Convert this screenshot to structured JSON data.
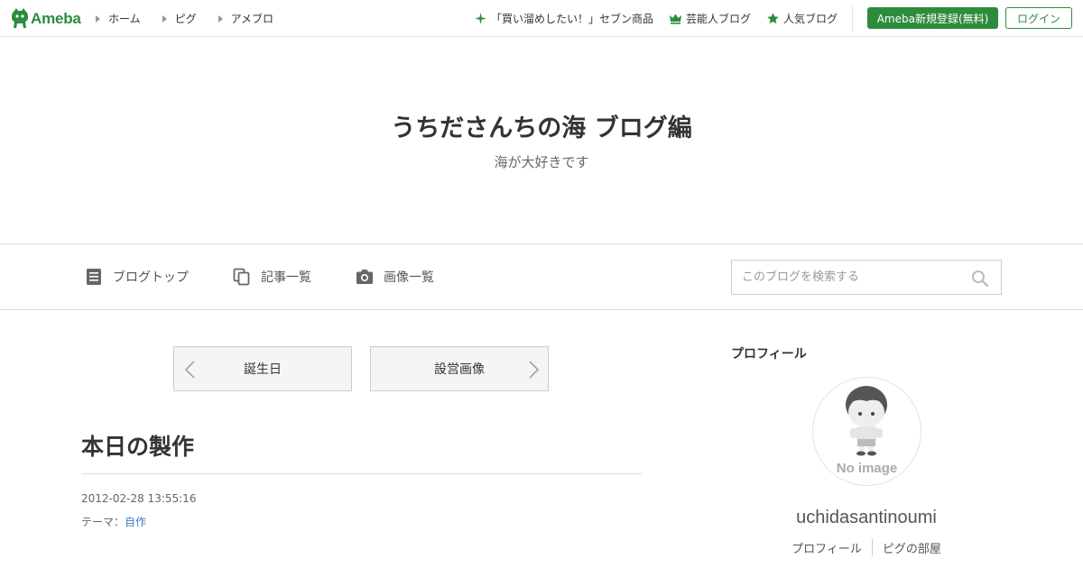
{
  "header": {
    "logo_text": "Ameba",
    "left_nav": [
      {
        "label": "ホーム"
      },
      {
        "label": "ピグ"
      },
      {
        "label": "アメブロ"
      }
    ],
    "right_nav": [
      {
        "label": "「買い溜めしたい！」セブン商品",
        "icon": "sparkle-icon"
      },
      {
        "label": "芸能人ブログ",
        "icon": "crown-icon"
      },
      {
        "label": "人気ブログ",
        "icon": "star-icon"
      }
    ],
    "register_label": "Ameba新規登録(無料)",
    "login_label": "ログイン"
  },
  "blog": {
    "title": "うちださんちの海 ブログ編",
    "subtitle": "海が大好きです"
  },
  "blog_nav": {
    "items": [
      {
        "label": "ブログトップ",
        "icon": "document-icon"
      },
      {
        "label": "記事一覧",
        "icon": "copy-icon"
      },
      {
        "label": "画像一覧",
        "icon": "camera-icon"
      }
    ],
    "search_placeholder": "このブログを検索する"
  },
  "pager": {
    "prev_label": "誕生日",
    "next_label": "設営画像"
  },
  "article": {
    "title": "本日の製作",
    "date": "2012-02-28 13:55:16",
    "theme_prefix": "テーマ：",
    "theme_label": "自作"
  },
  "sidebar": {
    "heading": "プロフィール",
    "no_image_text": "No image",
    "username": "uchidasantinoumi",
    "links": [
      {
        "label": "プロフィール"
      },
      {
        "label": "ピグの部屋"
      }
    ]
  },
  "colors": {
    "brand_green": "#2d8c3c",
    "link_blue": "#3b7cc1"
  }
}
